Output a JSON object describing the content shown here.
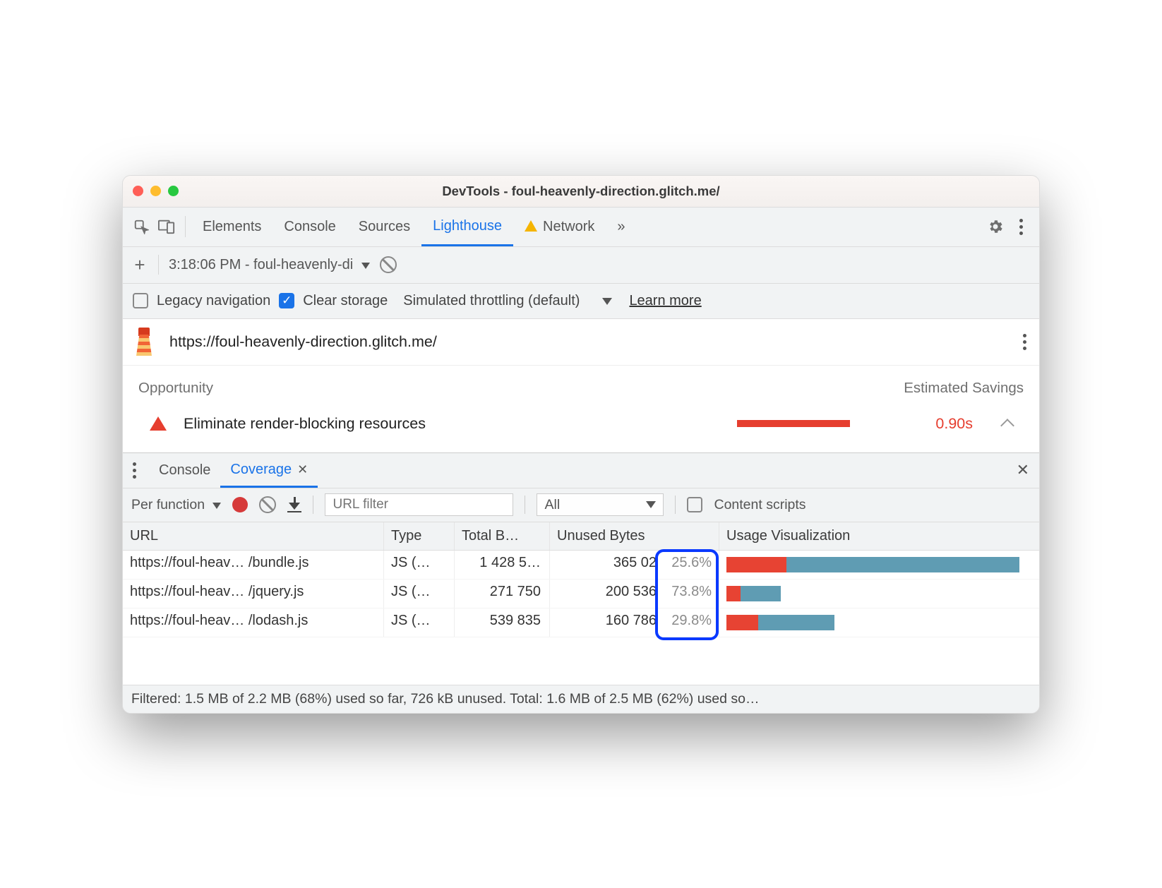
{
  "window": {
    "title": "DevTools - foul-heavenly-direction.glitch.me/"
  },
  "tabs": {
    "elements": "Elements",
    "console": "Console",
    "sources": "Sources",
    "lighthouse": "Lighthouse",
    "network": "Network",
    "more": "»"
  },
  "runbar": {
    "plus": "+",
    "run_label": "3:18:06 PM - foul-heavenly-di"
  },
  "options": {
    "legacy": "Legacy navigation",
    "clear": "Clear storage",
    "throttling": "Simulated throttling (default)",
    "learn": "Learn more"
  },
  "page_url": "https://foul-heavenly-direction.glitch.me/",
  "opportunity": {
    "head_left": "Opportunity",
    "head_right": "Estimated Savings",
    "label": "Eliminate render-blocking resources",
    "savings": "0.90s",
    "bar_pct": 78
  },
  "drawer": {
    "console": "Console",
    "coverage": "Coverage"
  },
  "coverage_toolbar": {
    "mode": "Per function",
    "filter_placeholder": "URL filter",
    "type_filter": "All",
    "content_scripts": "Content scripts"
  },
  "coverage_columns": {
    "url": "URL",
    "type": "Type",
    "total": "Total B…",
    "unused": "Unused Bytes",
    "viz": "Usage Visualization"
  },
  "coverage_rows": [
    {
      "url": "https://foul-heav… /bundle.js",
      "type": "JS (…",
      "total": "1 428 5…",
      "unused": "365 02",
      "pct": "25.6%",
      "used_w": 85,
      "unused_w": 330
    },
    {
      "url": "https://foul-heav… /jquery.js",
      "type": "JS (…",
      "total": "271 750",
      "unused": "200 536",
      "pct": "73.8%",
      "used_w": 20,
      "unused_w": 57
    },
    {
      "url": "https://foul-heav… /lodash.js",
      "type": "JS (…",
      "total": "539 835",
      "unused": "160 786",
      "pct": "29.8%",
      "used_w": 45,
      "unused_w": 108
    }
  ],
  "status_line": "Filtered: 1.5 MB of 2.2 MB (68%) used so far, 726 kB unused. Total: 1.6 MB of 2.5 MB (62%) used so…"
}
